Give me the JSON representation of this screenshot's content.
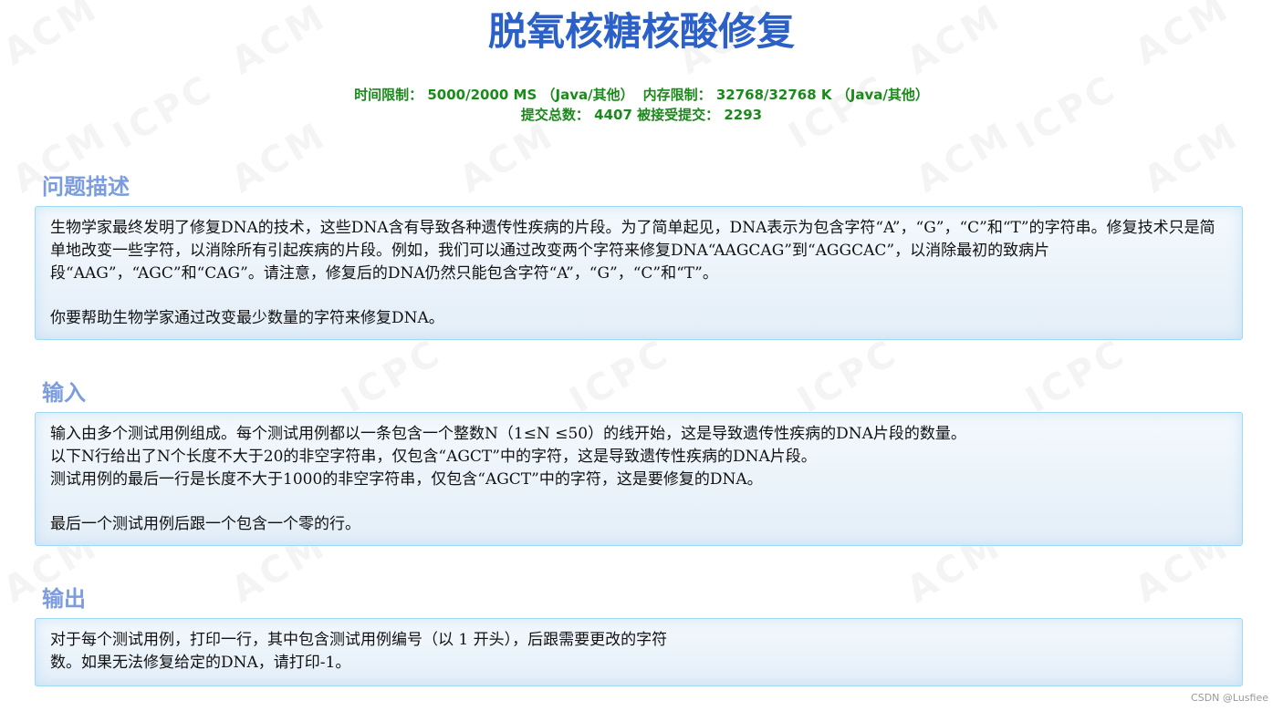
{
  "problem": {
    "title": "脱氧核糖核酸修复",
    "limits_line1_a": "时间限制： 5000/2000 MS （Java/其他）",
    "limits_line1_b": "内存限制： 32768/32768 K （Java/其他）",
    "limits_line2": "提交总数： 4407 被接受提交： 2293"
  },
  "sections": {
    "description": {
      "heading": "问题描述",
      "para1": "生物学家最终发明了修复DNA的技术，这些DNA含有导致各种遗传性疾病的片段。为了简单起见，DNA表示为包含字符“A”，“G”，“C”和“T”的字符串。修复技术只是简单地改变一些字符，以消除所有引起疾病的片段。例如，我们可以通过改变两个字符来修复DNA“AAGCAG”到“AGGCAC”，以消除最初的致病片段“AAG”，“AGC”和“CAG”。请注意，修复后的DNA仍然只能包含字符“A”，“G”，“C”和“T”。",
      "para2": "你要帮助生物学家通过改变最少数量的字符来修复DNA。"
    },
    "input": {
      "heading": "输入",
      "line1": "输入由多个测试用例组成。每个测试用例都以一条包含一个整数N（1≤N ≤50）的线开始，这是导致遗传性疾病的DNA片段的数量。",
      "line2": "以下N行给出了N个长度不大于20的非空字符串，仅包含“AGCT”中的字符，这是导致遗传性疾病的DNA片段。",
      "line3": "测试用例的最后一行是长度不大于1000的非空字符串，仅包含“AGCT”中的字符，这是要修复的DNA。",
      "line4": "最后一个测试用例后跟一个包含一个零的行。"
    },
    "output": {
      "heading": "输出",
      "line1": "对于每个测试用例，打印一行，其中包含测试用例编号（以 1 开头），后跟需要更改的字符",
      "line2": "数。如果无法修复给定的DNA，请打印-1。"
    }
  },
  "watermark": {
    "acm": "ACM",
    "icpc": "ICPC",
    "credit": "CSDN @Lusfiee"
  }
}
